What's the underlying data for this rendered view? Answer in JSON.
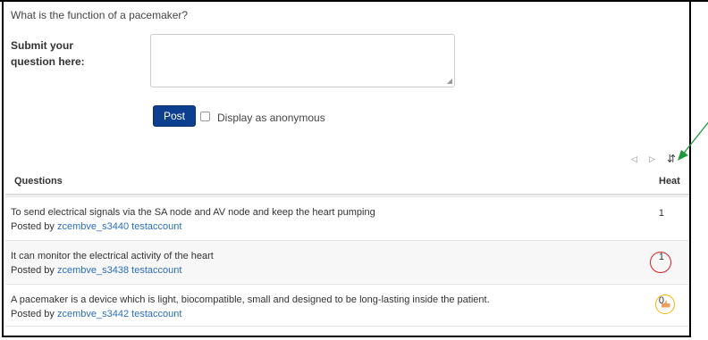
{
  "prompt": "What is the function of a pacemaker?",
  "form": {
    "submit_label_line1": "Submit your",
    "submit_label_line2": "question here:",
    "textarea_value": "",
    "post_label": "Post",
    "anonymous_label": "Display as anonymous"
  },
  "table": {
    "headers": {
      "questions": "Questions",
      "heat": "Heat"
    },
    "rows": [
      {
        "text": "To send electrical signals via the SA node and AV node and keep the heart pumping",
        "posted_prefix": "Posted by ",
        "author": "zcembve_s3440 testaccount",
        "heat": "1"
      },
      {
        "text": "It can monitor the electrical activity of the heart",
        "posted_prefix": "Posted by ",
        "author": "zcembve_s3438 testaccount",
        "heat": "1"
      },
      {
        "text": "A pacemaker is a device which is light, biocompatible, small and designed to be long-lasting inside the patient.",
        "posted_prefix": "Posted by ",
        "author": "zcembve_s3442 testaccount",
        "heat": "0"
      }
    ]
  },
  "colors": {
    "post_button": "#0d3f8f",
    "link": "#2a6ebb",
    "annotation_arrow": "#1a9a3a",
    "annotation_red": "#d62020",
    "annotation_yellow": "#f0b400"
  },
  "icons": {
    "prev": "triangle-left-icon",
    "next": "triangle-right-icon",
    "refresh": "refresh-icon"
  }
}
